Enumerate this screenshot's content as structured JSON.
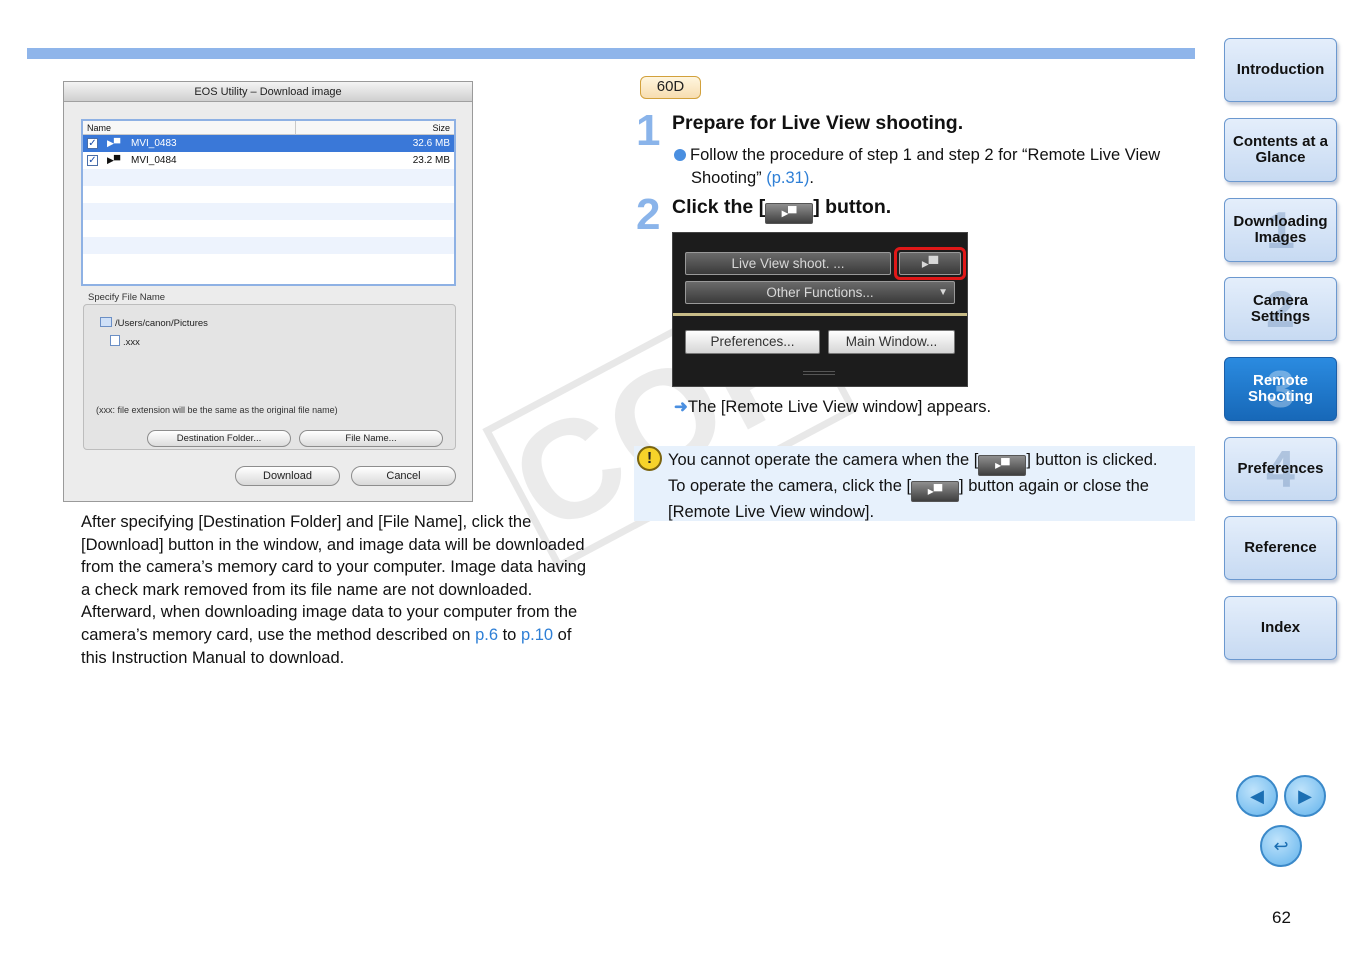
{
  "dialog": {
    "title": "EOS Utility – Download image",
    "columns": {
      "name": "Name",
      "size": "Size"
    },
    "files": [
      {
        "name": "MVI_0483",
        "size": "32.6 MB",
        "checked": true,
        "selected": true
      },
      {
        "name": "MVI_0484",
        "size": "23.2 MB",
        "checked": true,
        "selected": false
      }
    ],
    "specify_label": "Specify File Name",
    "path": "/Users/canon/Pictures",
    "filename": ".xxx",
    "note": "(xxx: file extension will be the same as the original file name)",
    "dest_button": "Destination Folder...",
    "file_button": "File Name...",
    "download_button": "Download",
    "cancel_button": "Cancel"
  },
  "paragraph": {
    "part1": "After specifying [Destination Folder] and [File Name], click the [Download] button in the window, and image data will be downloaded from the camera’s memory card to your computer. Image data having a check mark removed from its file name are not downloaded. Afterward, when downloading image data to your computer from the camera’s memory card, use the method described on ",
    "link1": "p.6",
    "part2": " to ",
    "link2": "p.10",
    "part3": " of this Instruction Manual to download."
  },
  "badge": "60D",
  "step1": {
    "num": "1",
    "title": "Prepare for Live View shooting.",
    "bullet": "Follow the procedure of step 1 and step 2 for “Remote Live View Shooting” ",
    "link": "(p.31)",
    "end": "."
  },
  "step2": {
    "num": "2",
    "title_pre": "Click the [",
    "title_post": "] button."
  },
  "liveview_panel": {
    "btn_live": "Live View shoot. ...",
    "btn_other": "Other Functions...",
    "btn_prefs": "Preferences...",
    "btn_main": "Main Window..."
  },
  "result": "The [Remote Live View window] appears.",
  "caution": {
    "line1_pre": "You cannot operate the camera when the [",
    "line1_post": "] button is clicked.",
    "line2_pre": "To operate the camera, click the [",
    "line2_post": "] button again or close the [Remote Live View window]."
  },
  "watermark": "COPY",
  "nav": [
    {
      "label": "Introduction",
      "num": ""
    },
    {
      "label": "Contents at a Glance",
      "num": ""
    },
    {
      "label": "Downloading Images",
      "num": "1"
    },
    {
      "label": "Camera Settings",
      "num": "2"
    },
    {
      "label": "Remote Shooting",
      "num": "3",
      "active": true
    },
    {
      "label": "Preferences",
      "num": "4"
    },
    {
      "label": "Reference",
      "num": ""
    },
    {
      "label": "Index",
      "num": ""
    }
  ],
  "page_number": "62",
  "colors": {
    "accent": "#8fb5ea",
    "link": "#2e7fd6",
    "active_tab": "#1f78cc"
  }
}
